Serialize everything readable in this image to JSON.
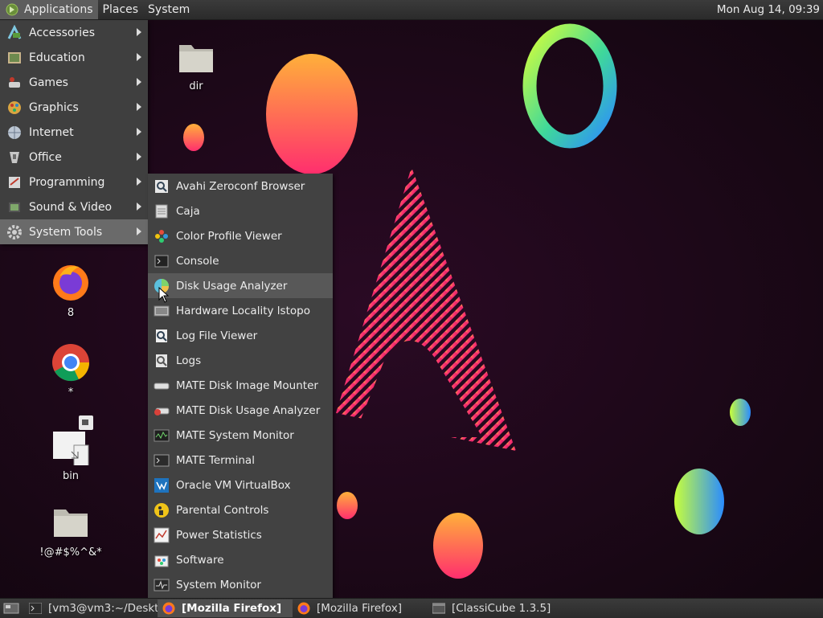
{
  "top_panel": {
    "menus": [
      {
        "label": "Applications",
        "icon": "mate-logo-icon"
      },
      {
        "label": "Places"
      },
      {
        "label": "System"
      }
    ],
    "clock": "Mon Aug 14, 09:39"
  },
  "apps_menu": {
    "items": [
      {
        "label": "Accessories",
        "icon": "accessories-icon"
      },
      {
        "label": "Education",
        "icon": "education-icon"
      },
      {
        "label": "Games",
        "icon": "games-icon"
      },
      {
        "label": "Graphics",
        "icon": "graphics-icon"
      },
      {
        "label": "Internet",
        "icon": "internet-icon"
      },
      {
        "label": "Office",
        "icon": "office-icon"
      },
      {
        "label": "Programming",
        "icon": "programming-icon"
      },
      {
        "label": "Sound & Video",
        "icon": "sound-video-icon"
      },
      {
        "label": "System Tools",
        "icon": "system-tools-icon",
        "active": true
      }
    ]
  },
  "system_tools_menu": {
    "items": [
      {
        "label": "Avahi Zeroconf Browser",
        "icon": "avahi-icon"
      },
      {
        "label": "Caja",
        "icon": "caja-icon"
      },
      {
        "label": "Color Profile Viewer",
        "icon": "color-profile-icon"
      },
      {
        "label": "Console",
        "icon": "console-icon"
      },
      {
        "label": "Disk Usage Analyzer",
        "icon": "disk-usage-icon",
        "hovered": true
      },
      {
        "label": "Hardware Locality lstopo",
        "icon": "hardware-icon"
      },
      {
        "label": "Log File Viewer",
        "icon": "log-viewer-icon"
      },
      {
        "label": "Logs",
        "icon": "logs-icon"
      },
      {
        "label": "MATE Disk Image Mounter",
        "icon": "disk-mounter-icon"
      },
      {
        "label": "MATE Disk Usage Analyzer",
        "icon": "mate-disk-usage-icon"
      },
      {
        "label": "MATE System Monitor",
        "icon": "mate-system-monitor-icon"
      },
      {
        "label": "MATE Terminal",
        "icon": "terminal-icon"
      },
      {
        "label": "Oracle VM VirtualBox",
        "icon": "virtualbox-icon"
      },
      {
        "label": "Parental Controls",
        "icon": "parental-controls-icon"
      },
      {
        "label": "Power Statistics",
        "icon": "power-statistics-icon"
      },
      {
        "label": "Software",
        "icon": "software-icon"
      },
      {
        "label": "System Monitor",
        "icon": "system-monitor-icon"
      }
    ]
  },
  "desktop_icons": [
    {
      "label": "dir",
      "icon": "folder-icon"
    },
    {
      "label": "8",
      "icon": "firefox-icon"
    },
    {
      "label": "*",
      "icon": "chrome-icon"
    },
    {
      "label": "bin",
      "icon": "symlink-file-icon"
    },
    {
      "label": "!@#$%^&*",
      "icon": "folder-icon"
    }
  ],
  "taskbar": {
    "tasks": [
      {
        "label": "[vm3@vm3:~/Deskt...",
        "icon": "terminal-icon",
        "active": false
      },
      {
        "label": "[Mozilla Firefox]",
        "icon": "firefox-icon",
        "active": true
      },
      {
        "label": "[Mozilla Firefox]",
        "icon": "firefox-icon",
        "active": false
      },
      {
        "label": "[ClassiCube 1.3.5]",
        "icon": "window-icon",
        "active": false
      }
    ]
  },
  "colors": {
    "panel": "#2f2f2f",
    "menu_bg": "#3f3f3f",
    "menu_active": "#6a6a6a",
    "desktop_bg": "#1a0817"
  }
}
